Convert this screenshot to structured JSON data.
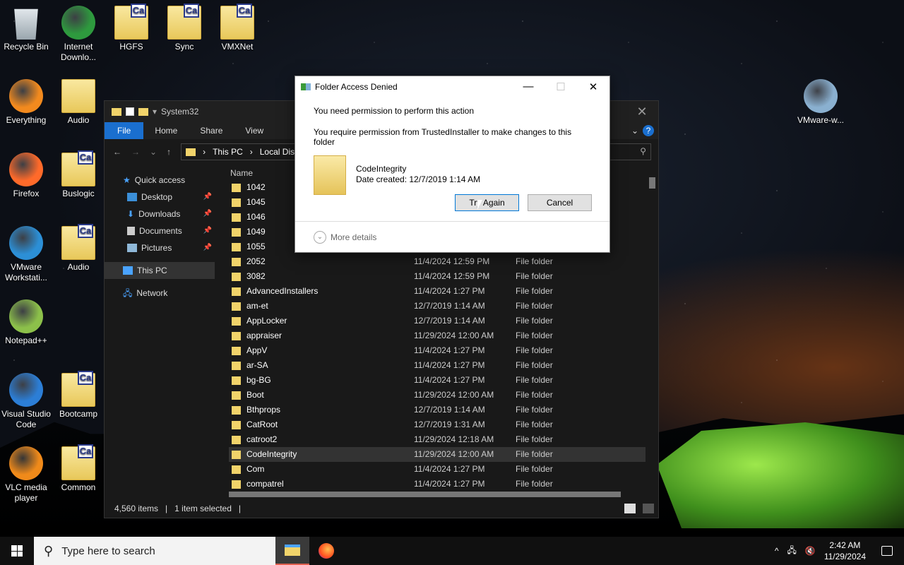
{
  "desktop": {
    "icons": [
      {
        "label": "Recycle Bin",
        "kind": "bin"
      },
      {
        "label": "Internet Downlo...",
        "kind": "idm"
      },
      {
        "label": "HGFS",
        "kind": "folder"
      },
      {
        "label": "Sync",
        "kind": "folder"
      },
      {
        "label": "VMXNet",
        "kind": "folder"
      },
      {
        "label": "Everything",
        "kind": "search"
      },
      {
        "label": "Audio",
        "kind": "plain-folder"
      },
      {
        "label": "Firefox",
        "kind": "firefox"
      },
      {
        "label": "Buslogic",
        "kind": "folder"
      },
      {
        "label": "VMware Workstati...",
        "kind": "vmware"
      },
      {
        "label": "Audio",
        "kind": "folder"
      },
      {
        "label": "Notepad++",
        "kind": "notepad"
      },
      {
        "label": "Visual Studio Code",
        "kind": "vscode"
      },
      {
        "label": "Bootcamp",
        "kind": "folder"
      },
      {
        "label": "VLC media player",
        "kind": "vlc"
      },
      {
        "label": "Common",
        "kind": "folder"
      },
      {
        "label": "VMware-w...",
        "kind": "installer"
      }
    ]
  },
  "explorer": {
    "title": "System32",
    "ribbon": [
      "File",
      "Home",
      "Share",
      "View"
    ],
    "breadcrumb": [
      "This PC",
      "Local Disk ("
    ],
    "nav": {
      "quick_access": "Quick access",
      "desktop": "Desktop",
      "downloads": "Downloads",
      "documents": "Documents",
      "pictures": "Pictures",
      "this_pc": "This PC",
      "network": "Network"
    },
    "column_name": "Name",
    "rows": [
      {
        "name": "1042",
        "date": "",
        "type": ""
      },
      {
        "name": "1045",
        "date": "",
        "type": ""
      },
      {
        "name": "1046",
        "date": "",
        "type": ""
      },
      {
        "name": "1049",
        "date": "",
        "type": ""
      },
      {
        "name": "1055",
        "date": "",
        "type": ""
      },
      {
        "name": "2052",
        "date": "11/4/2024 12:59 PM",
        "type": "File folder"
      },
      {
        "name": "3082",
        "date": "11/4/2024 12:59 PM",
        "type": "File folder"
      },
      {
        "name": "AdvancedInstallers",
        "date": "11/4/2024 1:27 PM",
        "type": "File folder"
      },
      {
        "name": "am-et",
        "date": "12/7/2019 1:14 AM",
        "type": "File folder"
      },
      {
        "name": "AppLocker",
        "date": "12/7/2019 1:14 AM",
        "type": "File folder"
      },
      {
        "name": "appraiser",
        "date": "11/29/2024 12:00 AM",
        "type": "File folder"
      },
      {
        "name": "AppV",
        "date": "11/4/2024 1:27 PM",
        "type": "File folder"
      },
      {
        "name": "ar-SA",
        "date": "11/4/2024 1:27 PM",
        "type": "File folder"
      },
      {
        "name": "bg-BG",
        "date": "11/4/2024 1:27 PM",
        "type": "File folder"
      },
      {
        "name": "Boot",
        "date": "11/29/2024 12:00 AM",
        "type": "File folder"
      },
      {
        "name": "Bthprops",
        "date": "12/7/2019 1:14 AM",
        "type": "File folder"
      },
      {
        "name": "CatRoot",
        "date": "12/7/2019 1:31 AM",
        "type": "File folder"
      },
      {
        "name": "catroot2",
        "date": "11/29/2024 12:18 AM",
        "type": "File folder"
      },
      {
        "name": "CodeIntegrity",
        "date": "11/29/2024 12:00 AM",
        "type": "File folder",
        "selected": true
      },
      {
        "name": "Com",
        "date": "11/4/2024 1:27 PM",
        "type": "File folder"
      },
      {
        "name": "compatrel",
        "date": "11/4/2024 1:27 PM",
        "type": "File folder"
      }
    ],
    "status": {
      "items": "4,560 items",
      "selected": "1 item selected"
    }
  },
  "dialog": {
    "title": "Folder Access Denied",
    "line1": "You need permission to perform this action",
    "line2": "You require permission from TrustedInstaller to make changes to this folder",
    "item_name": "CodeIntegrity",
    "item_date": "Date created: 12/7/2019 1:14 AM",
    "try_again": "Try Again",
    "cancel": "Cancel",
    "more_details": "More details"
  },
  "taskbar": {
    "search_placeholder": "Type here to search",
    "time": "2:42 AM",
    "date": "11/29/2024"
  }
}
